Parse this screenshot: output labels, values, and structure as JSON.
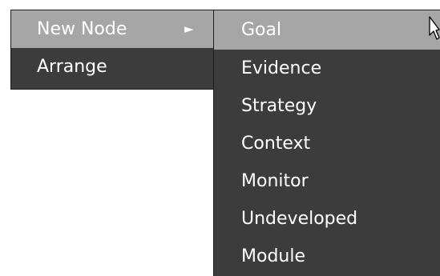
{
  "main_menu": {
    "items": [
      {
        "label": "New Node",
        "arrow": "►"
      },
      {
        "label": "Arrange"
      }
    ]
  },
  "sub_menu": {
    "items": [
      {
        "label": "Goal"
      },
      {
        "label": "Evidence"
      },
      {
        "label": "Strategy"
      },
      {
        "label": "Context"
      },
      {
        "label": "Monitor"
      },
      {
        "label": "Undeveloped"
      },
      {
        "label": "Module"
      }
    ]
  },
  "colors": {
    "menu_background": "#3c3c3c",
    "highlight": "#a6a6a6",
    "text": "#ffffff"
  },
  "icons": {
    "submenu_arrow": "submenu-arrow-icon",
    "pointer": "mouse-pointer-icon"
  }
}
